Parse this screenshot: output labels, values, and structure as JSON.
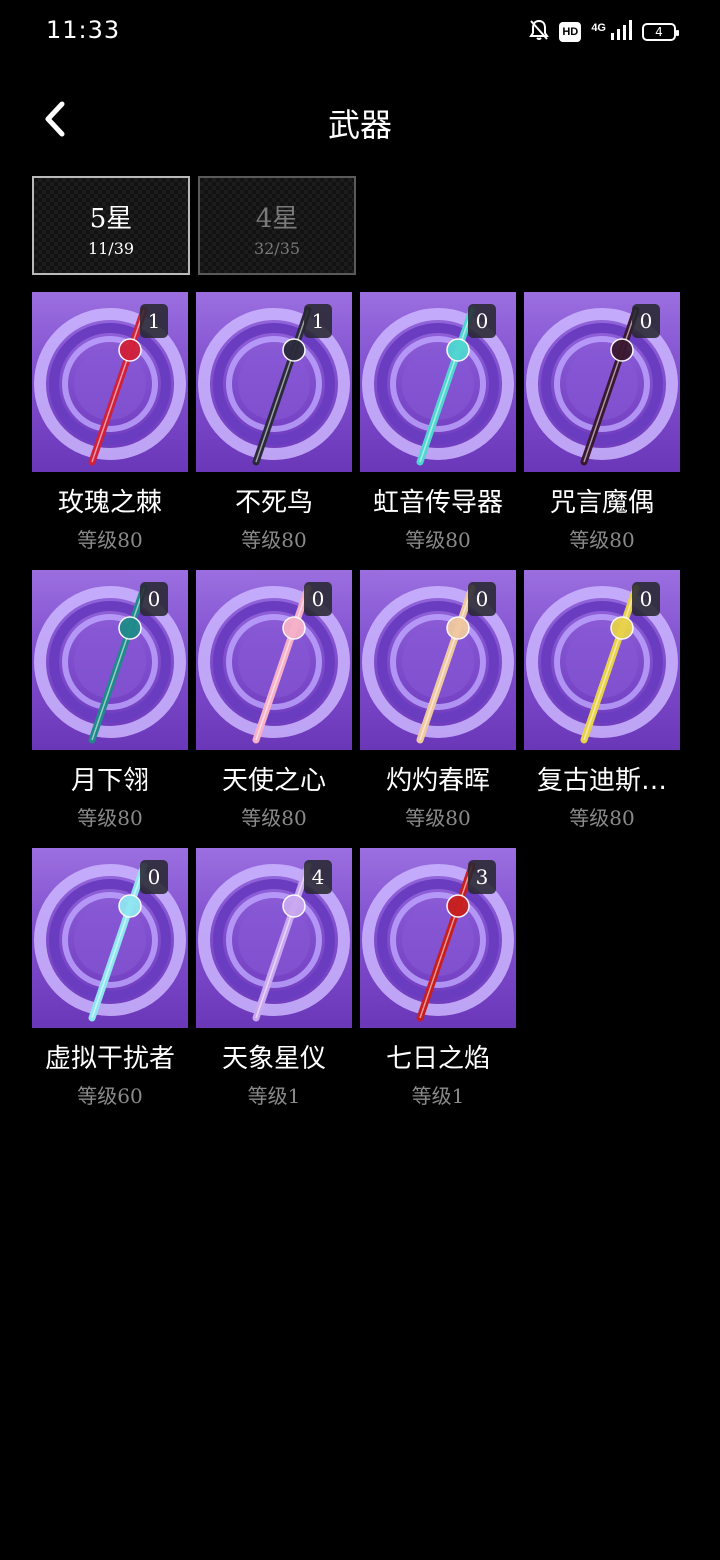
{
  "status_bar": {
    "time": "11:33",
    "icons": [
      "mute-bell-icon",
      "hd-icon",
      "signal-4g-icon",
      "battery-icon"
    ],
    "hd": "HD",
    "network": "4G",
    "battery": "4"
  },
  "header": {
    "title": "武器",
    "back_icon": "chevron-left-icon"
  },
  "tabs": [
    {
      "label": "5星",
      "count": "11/39",
      "selected": true
    },
    {
      "label": "4星",
      "count": "32/35",
      "selected": false
    }
  ],
  "weapons": [
    {
      "name": "玫瑰之棘",
      "level": "等级80",
      "count": "1",
      "accent": "#d0203a"
    },
    {
      "name": "不死鸟",
      "level": "等级80",
      "count": "1",
      "accent": "#2a2a3a"
    },
    {
      "name": "虹音传导器",
      "level": "等级80",
      "count": "0",
      "accent": "#4fd6d0"
    },
    {
      "name": "咒言魔偶",
      "level": "等级80",
      "count": "0",
      "accent": "#3a1830"
    },
    {
      "name": "月下翎",
      "level": "等级80",
      "count": "0",
      "accent": "#1f8a8a"
    },
    {
      "name": "天使之心",
      "level": "等级80",
      "count": "0",
      "accent": "#f6b0c8"
    },
    {
      "name": "灼灼春晖",
      "level": "等级80",
      "count": "0",
      "accent": "#f0c8a0"
    },
    {
      "name": "复古迪斯…",
      "level": "等级80",
      "count": "0",
      "accent": "#e8d24a"
    },
    {
      "name": "虚拟干扰者",
      "level": "等级60",
      "count": "0",
      "accent": "#8fe6f0"
    },
    {
      "name": "天象星仪",
      "level": "等级1",
      "count": "4",
      "accent": "#c9a8f0"
    },
    {
      "name": "七日之焰",
      "level": "等级1",
      "count": "3",
      "accent": "#c81e1e"
    }
  ]
}
